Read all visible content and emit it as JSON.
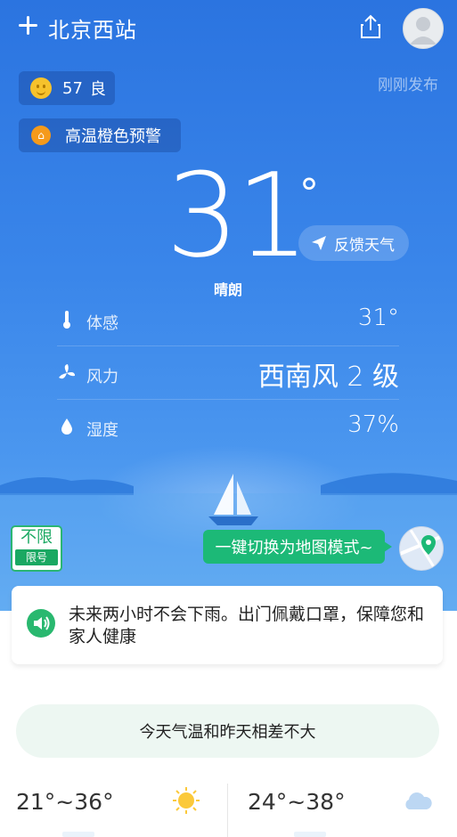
{
  "header": {
    "city": "北京西站",
    "add_icon": "plus-icon",
    "share_icon": "share-icon",
    "avatar_icon": "avatar-icon"
  },
  "air": {
    "aqi_value": "57",
    "aqi_level": "良",
    "icon": "smiley-face-icon"
  },
  "alert": {
    "label": "高温橙色预警",
    "icon": "warning-icon"
  },
  "published": "刚刚发布",
  "current": {
    "temperature": "31",
    "degree_symbol": "°",
    "condition": "晴朗"
  },
  "feedback": {
    "label": "反馈天气",
    "icon": "send-icon"
  },
  "details": [
    {
      "label": "体感",
      "value": "31°",
      "icon": "thermometer-icon"
    },
    {
      "label": "风力",
      "value": "西南风 2 级",
      "icon": "wind-icon"
    },
    {
      "label": "湿度",
      "value": "37%",
      "icon": "water-drop-icon"
    }
  ],
  "traffic": {
    "top": "不限",
    "bottom": "限号"
  },
  "map_mode": {
    "label": "一键切换为地图模式~",
    "icon": "map-pin-icon"
  },
  "tip": {
    "text": "未来两小时不会下雨。出门佩戴口罩，保障您和家人健康",
    "icon": "speaker-icon"
  },
  "comparison": "今天气温和昨天相差不大",
  "forecast": [
    {
      "range": "21°~36°",
      "icon": "sun-icon"
    },
    {
      "range": "24°~38°",
      "icon": "cloud-icon"
    }
  ],
  "colors": {
    "sky_top": "#2b74e0",
    "sky_bottom": "#66aef3",
    "accent_green": "#1cb977"
  }
}
